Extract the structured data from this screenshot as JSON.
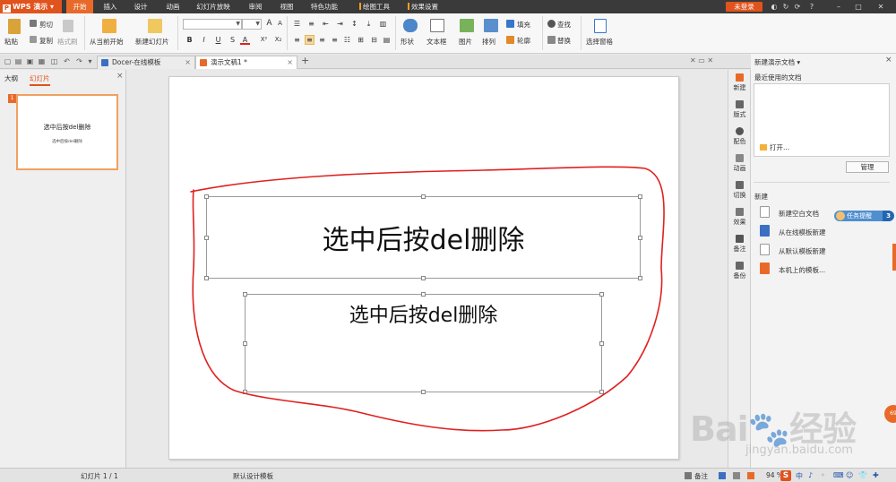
{
  "app": {
    "name": "WPS 演示",
    "logo_letter": "P"
  },
  "menu": {
    "tabs": [
      "开始",
      "插入",
      "设计",
      "动画",
      "幻灯片放映",
      "审阅",
      "视图",
      "特色功能",
      "绘图工具",
      "效果设置"
    ],
    "login": "未登录",
    "window_icons": [
      "◐",
      "↻",
      "⟳",
      "?",
      "–",
      "□",
      "✕"
    ]
  },
  "ribbon": {
    "paste": "粘贴",
    "cut": "剪切",
    "copy": "复制",
    "format_painter": "格式刷",
    "from_current": "从当前开始",
    "new_slide": "新建幻灯片",
    "font_size_up": "A",
    "font_size_down": "A",
    "bold": "B",
    "italic": "I",
    "underline": "U",
    "shadow": "S",
    "font_color": "A",
    "superscript": "X²",
    "subscript": "X₂",
    "shape": "形状",
    "textbox": "文本框",
    "picture": "图片",
    "arrange": "排列",
    "fill": "填充",
    "outline": "轮廓",
    "find": "查找",
    "replace": "替换",
    "select_pane": "选择窗格"
  },
  "tabs": {
    "docer": "Docer-在线模板",
    "doc": "演示文稿1 *",
    "close": "×",
    "add": "+"
  },
  "left_panel": {
    "outline_tab": "大纲",
    "slides_tab": "幻灯片",
    "close": "×",
    "thumb_number": "1",
    "thumb_title": "选中后按del删除",
    "thumb_sub": "选中后按del删除"
  },
  "slide": {
    "title": "选中后按del删除",
    "subtitle": "选中后按del删除"
  },
  "sidebar": {
    "items": [
      "新建",
      "版式",
      "配色",
      "动画",
      "切换",
      "效果",
      "备注",
      "备份"
    ]
  },
  "taskpane": {
    "header": "新建演示文档 ▾",
    "close": "×",
    "recent_label": "最近使用的文档",
    "open": "打开...",
    "manage": "管理",
    "new_label": "新建",
    "new_items": [
      "新建空白文档",
      "从在线模板新建",
      "从默认模板新建",
      "本机上的模板..."
    ],
    "task_remind": "任务提醒",
    "task_count": "3",
    "orange_bubble": "69"
  },
  "status": {
    "slide_count": "幻灯片 1 / 1",
    "template": "默认设计模板",
    "notes": "备注",
    "zoom": "94 %",
    "ime_logo": "S",
    "ime_items": [
      "中",
      "♪",
      "◦",
      "⌨",
      "☺",
      "👕",
      "✚"
    ]
  },
  "watermark": {
    "text": "Bai🐾经验",
    "url": "jingyan.baidu.com"
  },
  "colors": {
    "accent": "#e0531c",
    "menubar": "#3a3a3a",
    "annotation": "#e02020"
  }
}
